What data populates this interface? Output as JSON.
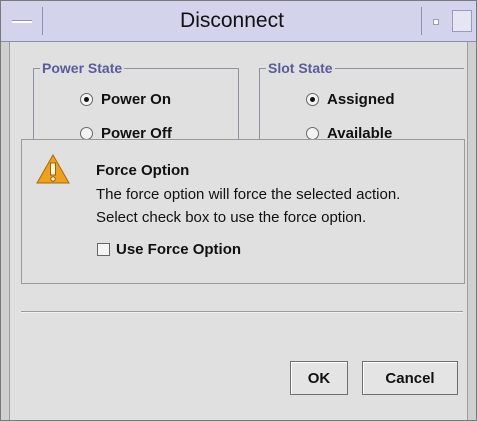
{
  "window": {
    "title": "Disconnect"
  },
  "power_state": {
    "label": "Power State",
    "options": [
      {
        "label": "Power On",
        "selected": true
      },
      {
        "label": "Power Off",
        "selected": false
      }
    ]
  },
  "slot_state": {
    "label": "Slot State",
    "options": [
      {
        "label": "Assigned",
        "selected": true
      },
      {
        "label": "Available",
        "selected": false
      }
    ]
  },
  "force": {
    "title": "Force Option",
    "line1": "The force option will force the selected action.",
    "line2": "Select check box to use the force option.",
    "checkbox_label": "Use Force Option",
    "checked": false,
    "icon": "warning-icon",
    "icon_color": "#f0a020"
  },
  "buttons": {
    "ok": "OK",
    "cancel": "Cancel"
  },
  "colors": {
    "titlebar": "#d4d3ec",
    "group_title": "#5b5b9b"
  }
}
